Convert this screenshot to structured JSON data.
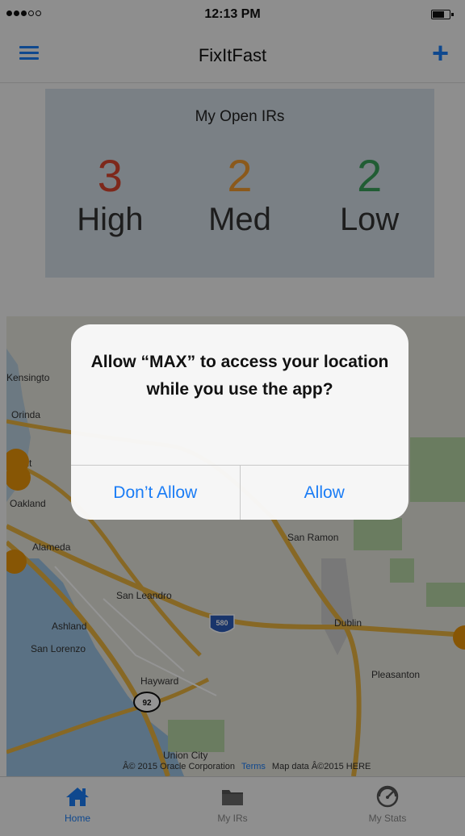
{
  "status_bar": {
    "time": "12:13 PM"
  },
  "nav": {
    "title": "FixItFast"
  },
  "summary": {
    "title": "My Open IRs",
    "stats": [
      {
        "count": "3",
        "label": "High",
        "color": "#d9452f"
      },
      {
        "count": "2",
        "label": "Med",
        "color": "#ef9a2f"
      },
      {
        "count": "2",
        "label": "Low",
        "color": "#3aa05a"
      }
    ]
  },
  "map": {
    "labels": {
      "kensington": "Kensingto",
      "orinda": "Orinda",
      "piedmont": "nont",
      "oakland": "Oakland",
      "alameda": "Alameda",
      "san_ramon": "San Ramon",
      "san_leandro": "San Leandro",
      "ashland": "Ashland",
      "san_lorenzo": "San Lorenzo",
      "dublin": "Dublin",
      "hayward": "Hayward",
      "pleasanton": "Pleasanton",
      "union_city": "Union City",
      "shield_580": "580",
      "shield_92": "92"
    },
    "credit": {
      "copyright": "Â© 2015 Oracle Corporation",
      "terms": "Terms",
      "data": "Map data Â©2015 HERE"
    }
  },
  "alert": {
    "message": "Allow “MAX” to access your location while you use the app?",
    "deny_label": "Don’t Allow",
    "allow_label": "Allow"
  },
  "tabs": [
    {
      "label": "Home",
      "icon": "home-icon",
      "active": true
    },
    {
      "label": "My IRs",
      "icon": "folder-icon",
      "active": false
    },
    {
      "label": "My Stats",
      "icon": "gauge-icon",
      "active": false
    }
  ],
  "colors": {
    "accent": "#1a7cf5",
    "pin": "#e8950a"
  }
}
